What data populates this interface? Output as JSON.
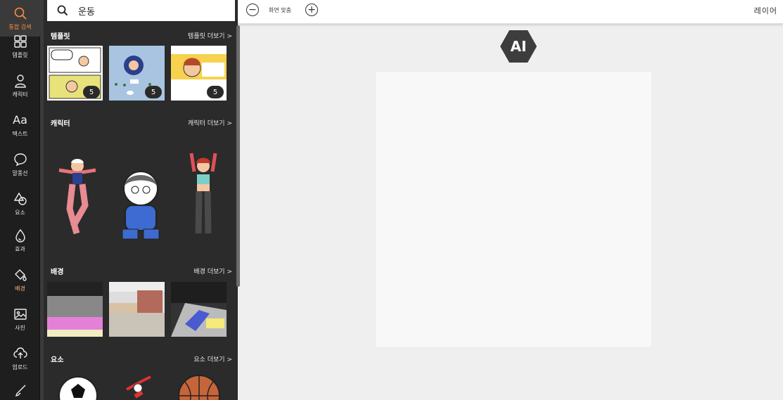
{
  "rail": {
    "items": [
      {
        "label": "통합 검색",
        "icon": "search-icon"
      },
      {
        "label": "템플릿",
        "icon": "grid-icon"
      },
      {
        "label": "캐릭터",
        "icon": "person-icon"
      },
      {
        "label": "텍스트",
        "icon": "text-icon"
      },
      {
        "label": "말풍선",
        "icon": "speech-bubble-icon"
      },
      {
        "label": "요소",
        "icon": "shapes-icon"
      },
      {
        "label": "효과",
        "icon": "drop-icon"
      },
      {
        "label": "배경",
        "icon": "paint-bucket-icon"
      },
      {
        "label": "사진",
        "icon": "image-icon"
      },
      {
        "label": "업로드",
        "icon": "upload-cloud-icon"
      }
    ],
    "active_color": "#ff8a3d"
  },
  "search": {
    "value": "운동"
  },
  "sections": {
    "templates": {
      "title": "템플릿",
      "more": "템플릿 더보기 >",
      "badges": [
        "5",
        "5",
        "5"
      ]
    },
    "characters": {
      "title": "캐릭터",
      "more": "캐릭터 더보기 >"
    },
    "backgrounds": {
      "title": "배경",
      "more": "배경 더보기 >"
    },
    "elements": {
      "title": "요소",
      "more": "요소 더보기 >"
    }
  },
  "toolbar": {
    "zoom_out": "−",
    "fit_label": "화면 맞춤",
    "zoom_in": "+",
    "layer_label": "레이어"
  },
  "canvas": {
    "ai_label": "AI"
  }
}
